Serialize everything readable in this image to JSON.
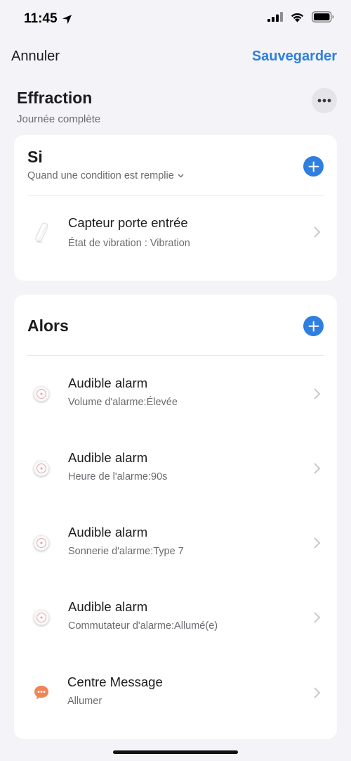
{
  "status_bar": {
    "time": "11:45",
    "location_icon": "location-arrow-icon",
    "signal_icon": "cellular-signal-icon",
    "wifi_icon": "wifi-icon",
    "battery_icon": "battery-icon"
  },
  "nav": {
    "cancel_label": "Annuler",
    "save_label": "Sauvegarder"
  },
  "scene": {
    "title": "Effraction",
    "subtitle": "Journée complète"
  },
  "si_section": {
    "title": "Si",
    "condition_mode": "Quand une condition est remplie",
    "rows": [
      {
        "title": "Capteur porte entrée",
        "subtitle": "État de vibration : Vibration",
        "icon": "door-sensor-icon"
      }
    ]
  },
  "alors_section": {
    "title": "Alors",
    "rows": [
      {
        "title": "Audible alarm",
        "subtitle": "Volume d'alarme:Élevée",
        "icon": "alarm-device-icon"
      },
      {
        "title": "Audible alarm",
        "subtitle": "Heure de l'alarme:90s",
        "icon": "alarm-device-icon"
      },
      {
        "title": "Audible alarm",
        "subtitle": "Sonnerie d'alarme:Type 7",
        "icon": "alarm-device-icon"
      },
      {
        "title": "Audible alarm",
        "subtitle": "Commutateur d'alarme:Allumé(e)",
        "icon": "alarm-device-icon"
      },
      {
        "title": "Centre Message",
        "subtitle": "Allumer",
        "icon": "message-bubble-icon"
      }
    ]
  },
  "colors": {
    "accent": "#2e7fe0",
    "background": "#f4f4f8",
    "card": "#ffffff",
    "message_icon": "#ef8557"
  }
}
